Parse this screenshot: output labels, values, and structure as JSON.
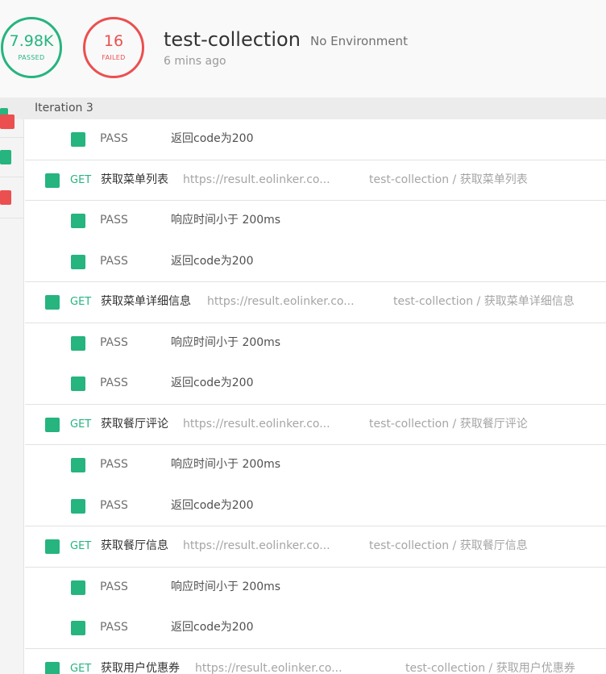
{
  "summary": {
    "passed_count": "7.98K",
    "passed_label": "PASSED",
    "failed_count": "16",
    "failed_label": "FAILED",
    "collection_name": "test-collection",
    "environment": "No Environment",
    "run_time": "6 mins ago"
  },
  "colors": {
    "pass": "#26b47f",
    "fail": "#ec4f4f"
  },
  "iteration_label": "Iteration 3",
  "sidebar_statuses": [
    "pass",
    "fail",
    "pass",
    "fail"
  ],
  "rows": [
    {
      "kind": "assertion",
      "status": "PASS",
      "text": "返回code为200"
    },
    {
      "kind": "request",
      "method": "GET",
      "name": "获取菜单列表",
      "url": "https://result.eolinker.co...",
      "collection": "test-collection",
      "sep": " / ",
      "request": "获取菜单列表"
    },
    {
      "kind": "assertion",
      "status": "PASS",
      "text": "响应时间小于 200ms"
    },
    {
      "kind": "assertion",
      "status": "PASS",
      "text": "返回code为200"
    },
    {
      "kind": "request",
      "method": "GET",
      "name": "获取菜单详细信息",
      "url": "https://result.eolinker.co...",
      "collection": "test-collection",
      "sep": " / ",
      "request": "获取菜单详细信息"
    },
    {
      "kind": "assertion",
      "status": "PASS",
      "text": "响应时间小于 200ms"
    },
    {
      "kind": "assertion",
      "status": "PASS",
      "text": "返回code为200"
    },
    {
      "kind": "request",
      "method": "GET",
      "name": "获取餐厅评论",
      "url": "https://result.eolinker.co...",
      "collection": "test-collection",
      "sep": " / ",
      "request": "获取餐厅评论"
    },
    {
      "kind": "assertion",
      "status": "PASS",
      "text": "响应时间小于 200ms"
    },
    {
      "kind": "assertion",
      "status": "PASS",
      "text": "返回code为200"
    },
    {
      "kind": "request",
      "method": "GET",
      "name": "获取餐厅信息",
      "url": "https://result.eolinker.co...",
      "collection": "test-collection",
      "sep": " / ",
      "request": "获取餐厅信息"
    },
    {
      "kind": "assertion",
      "status": "PASS",
      "text": "响应时间小于 200ms"
    },
    {
      "kind": "assertion",
      "status": "PASS",
      "text": "返回code为200"
    },
    {
      "kind": "request",
      "method": "GET",
      "name": "获取用户优惠券",
      "url": "https://result.eolinker.co...",
      "collection": "test-collection",
      "sep": " / ",
      "request": "获取用户优惠券"
    }
  ]
}
